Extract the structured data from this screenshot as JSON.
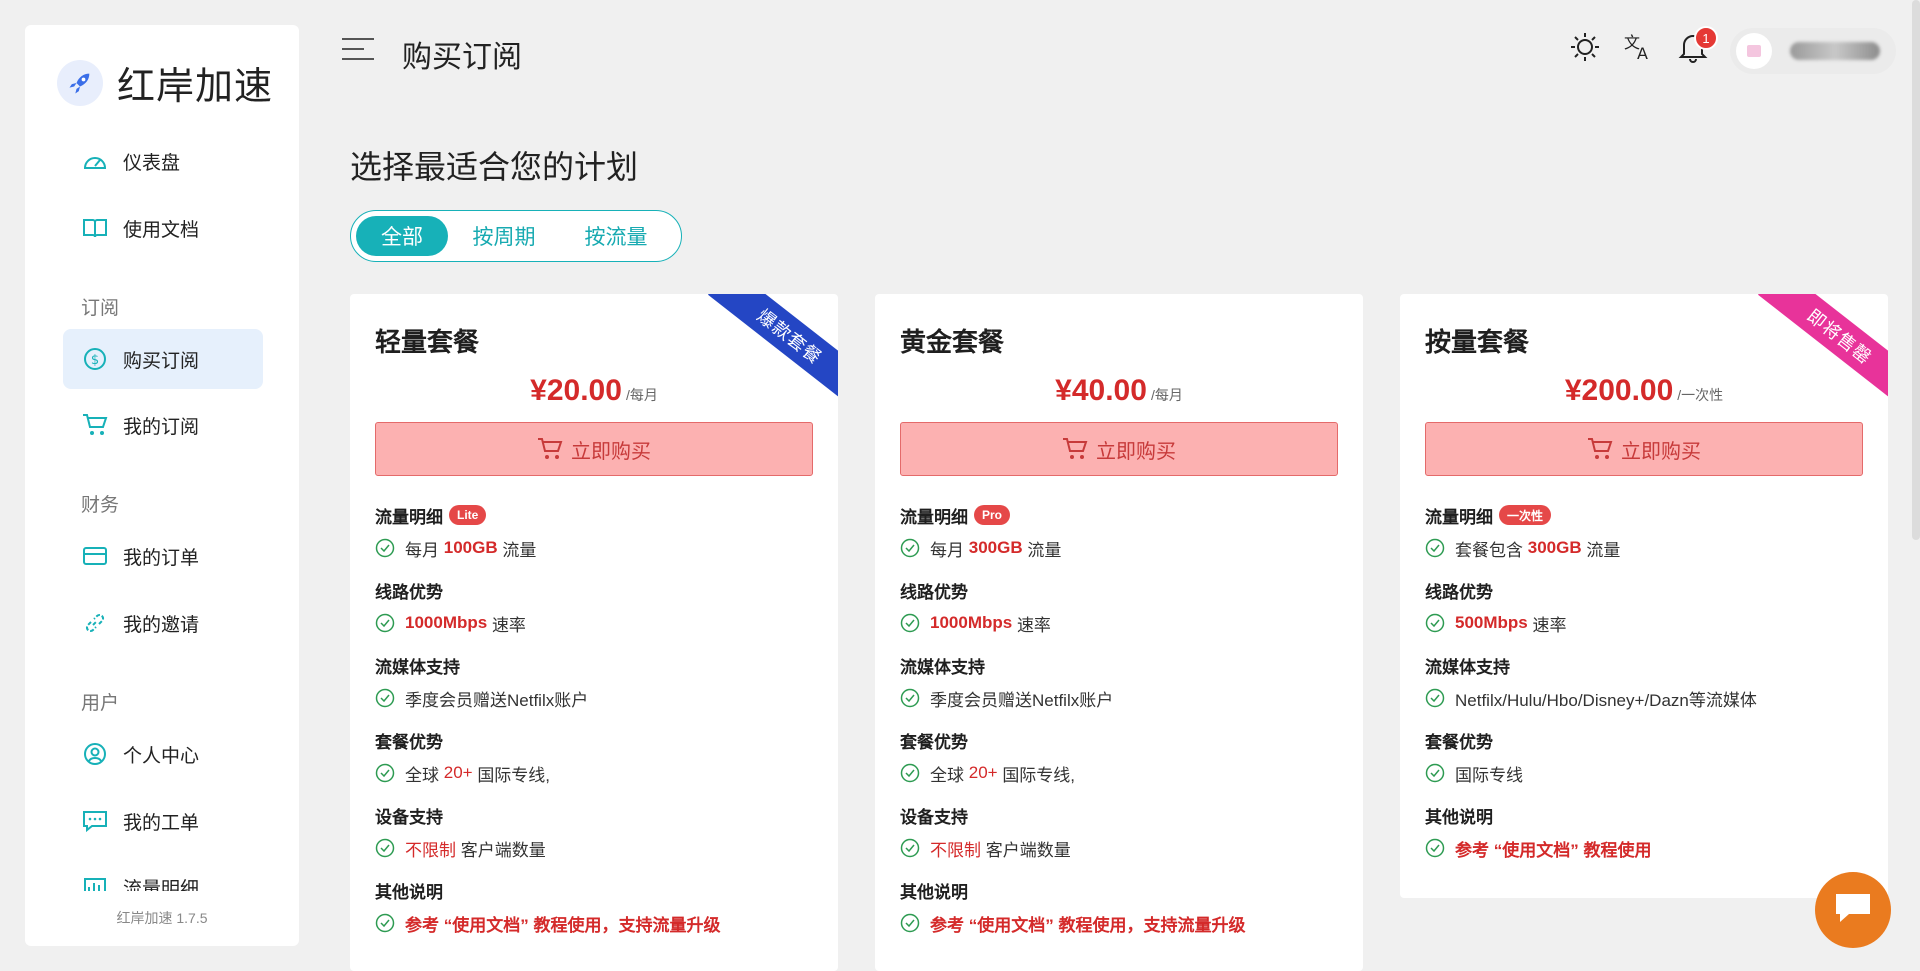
{
  "app": {
    "brand": "红岸加速",
    "version": "红岸加速 1.7.5"
  },
  "header": {
    "title": "购买订阅",
    "notifications_count": "1"
  },
  "sidebar": {
    "items": [
      {
        "label": "仪表盘",
        "icon": "dashboard-icon"
      },
      {
        "label": "使用文档",
        "icon": "book-icon"
      }
    ],
    "groups": [
      {
        "title": "订阅",
        "items": [
          {
            "label": "购买订阅",
            "icon": "dollar-icon",
            "active": true
          },
          {
            "label": "我的订阅",
            "icon": "cart-icon"
          }
        ]
      },
      {
        "title": "财务",
        "items": [
          {
            "label": "我的订单",
            "icon": "card-icon"
          },
          {
            "label": "我的邀请",
            "icon": "link-icon"
          }
        ]
      },
      {
        "title": "用户",
        "items": [
          {
            "label": "个人中心",
            "icon": "user-icon"
          },
          {
            "label": "我的工单",
            "icon": "ticket-icon"
          },
          {
            "label": "流量明细",
            "icon": "chart-icon"
          }
        ]
      }
    ]
  },
  "main": {
    "heading": "选择最适合您的计划",
    "filters": [
      {
        "label": "全部",
        "active": true
      },
      {
        "label": "按周期"
      },
      {
        "label": "按流量"
      }
    ],
    "plans": [
      {
        "name": "轻量套餐",
        "ribbon": "爆款套餐",
        "ribbon_color": "#2446c4",
        "price": "¥20.00",
        "period": "/每月",
        "buy": "立即购买",
        "traffic_head": "流量明细",
        "traffic_badge": "Lite",
        "traffic_pre": "每月",
        "traffic_val": "100GB",
        "traffic_post": "流量",
        "line_head": "线路优势",
        "speed": "1000Mbps",
        "speed_post": "速率",
        "media_head": "流媒体支持",
        "media": "季度会员赠送Netfilx账户",
        "adv_head": "套餐优势",
        "adv_pre": "全球",
        "adv_val": "20+",
        "adv_post": "国际专线,",
        "dev_head": "设备支持",
        "dev_val": "不限制",
        "dev_post": "客户端数量",
        "other_head": "其他说明",
        "other": "参考 “使用文档” 教程使用，支持流量升级"
      },
      {
        "name": "黄金套餐",
        "ribbon": "",
        "price": "¥40.00",
        "period": "/每月",
        "buy": "立即购买",
        "traffic_head": "流量明细",
        "traffic_badge": "Pro",
        "traffic_pre": "每月",
        "traffic_val": "300GB",
        "traffic_post": "流量",
        "line_head": "线路优势",
        "speed": "1000Mbps",
        "speed_post": "速率",
        "media_head": "流媒体支持",
        "media": "季度会员赠送Netfilx账户",
        "adv_head": "套餐优势",
        "adv_pre": "全球",
        "adv_val": "20+",
        "adv_post": "国际专线,",
        "dev_head": "设备支持",
        "dev_val": "不限制",
        "dev_post": "客户端数量",
        "other_head": "其他说明",
        "other": "参考 “使用文档” 教程使用，支持流量升级"
      },
      {
        "name": "按量套餐",
        "ribbon": "即将售罄",
        "ribbon_color": "#e8339a",
        "price": "¥200.00",
        "period": "/一次性",
        "buy": "立即购买",
        "traffic_head": "流量明细",
        "traffic_badge": "一次性",
        "traffic_pre": "套餐包含",
        "traffic_val": "300GB",
        "traffic_post": "流量",
        "line_head": "线路优势",
        "speed": "500Mbps",
        "speed_post": "速率",
        "media_head": "流媒体支持",
        "media": "Netfilx/Hulu/Hbo/Disney+/Dazn等流媒体",
        "adv_head": "套餐优势",
        "adv_text": "国际专线",
        "other_head": "其他说明",
        "other": "参考 “使用文档” 教程使用"
      }
    ]
  },
  "colors": {
    "accent": "#17b1b8",
    "price": "#d42a2a",
    "buy_bg": "#fcb1b1",
    "chat": "#ea7b1f"
  }
}
